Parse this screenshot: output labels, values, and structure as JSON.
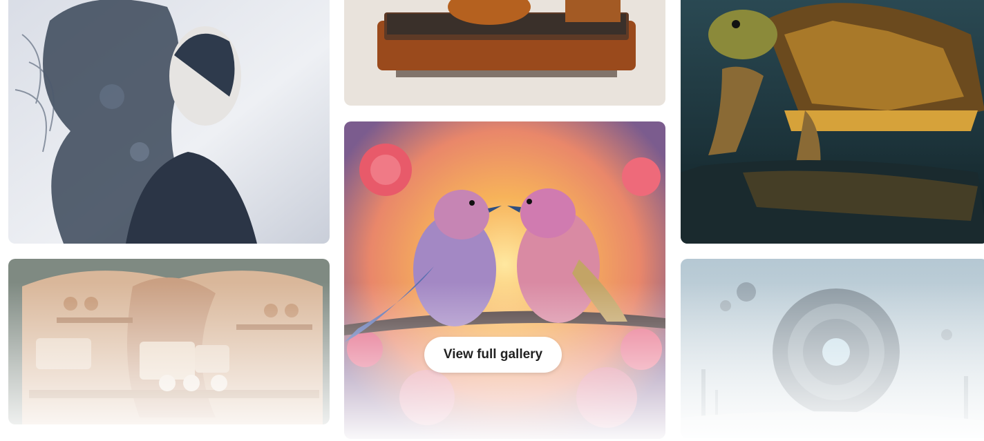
{
  "gallery": {
    "cta_label": "View full gallery",
    "tiles": [
      {
        "subject": "woman-portrait"
      },
      {
        "subject": "wooden-teapot"
      },
      {
        "subject": "golden-turtle"
      },
      {
        "subject": "paper-cafe"
      },
      {
        "subject": "love-birds"
      },
      {
        "subject": "floating-sphere"
      }
    ]
  },
  "colors": {
    "button_bg": "#ffffff",
    "button_text": "#222222",
    "page_bg": "#ffffff"
  }
}
